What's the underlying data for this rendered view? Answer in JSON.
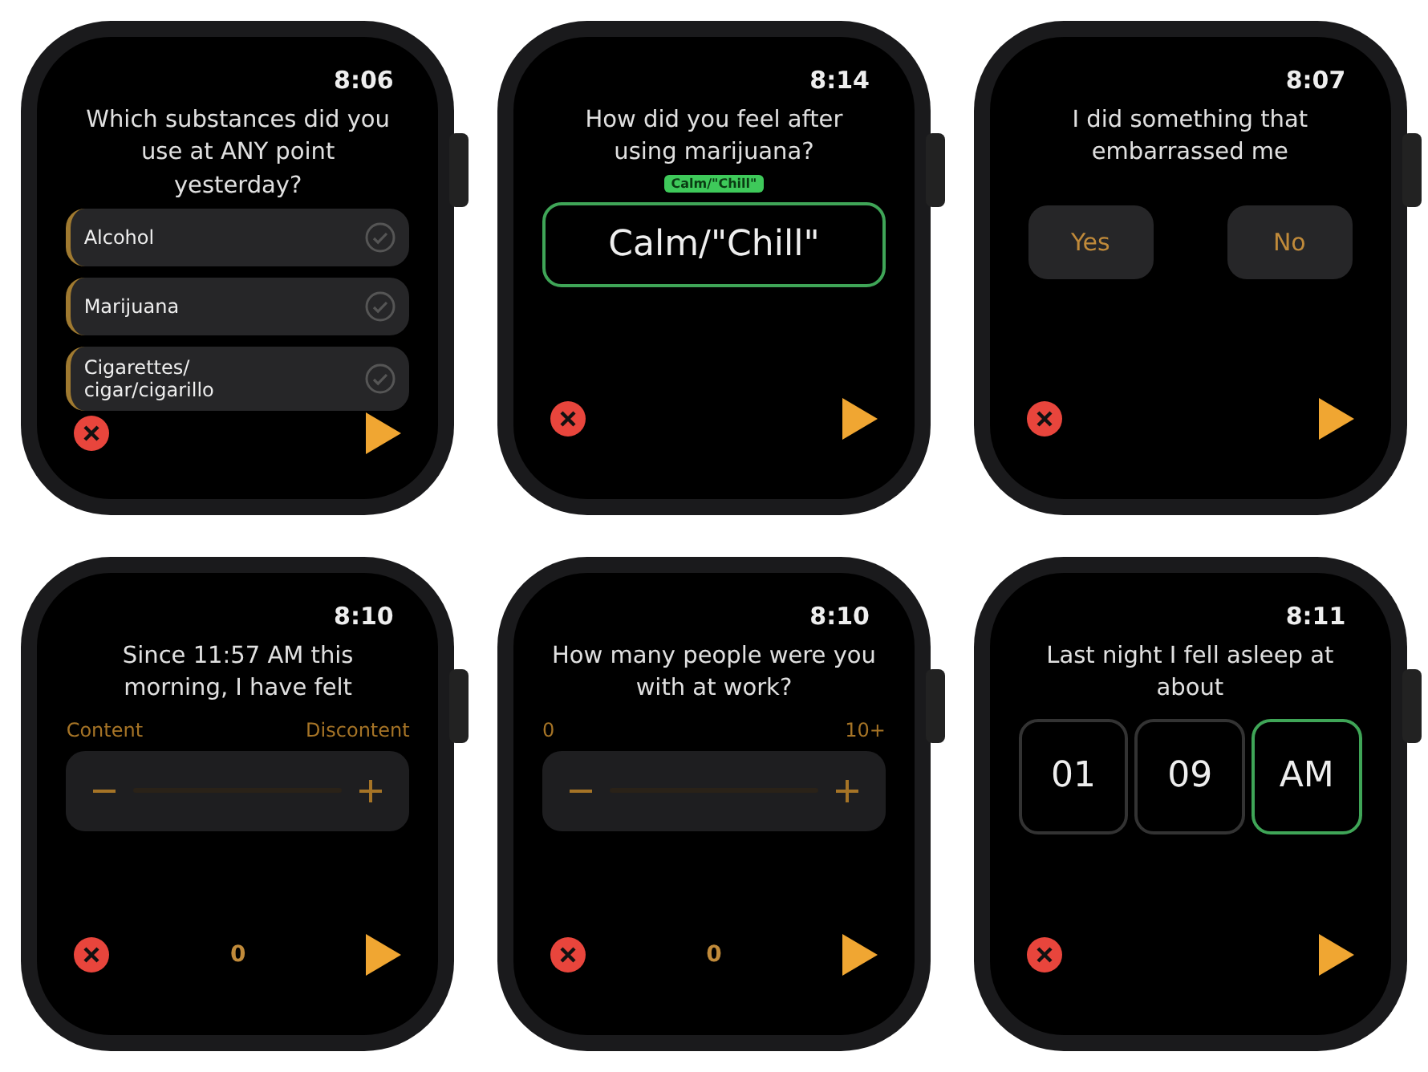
{
  "watches": [
    {
      "kind": "checklist",
      "time": "8:06",
      "question": "Which substances did you use at ANY point yesterday?",
      "options": [
        {
          "label": "Alcohol",
          "checked": false
        },
        {
          "label": "Marijuana",
          "checked": false
        },
        {
          "label": "Cigarettes/ cigar/cigarillo",
          "checked": false
        }
      ]
    },
    {
      "kind": "choice_text",
      "time": "8:14",
      "question": "How did you feel after using marijuana?",
      "tag": "Calm/\"Chill\"",
      "value": "Calm/\"Chill\""
    },
    {
      "kind": "yes_no",
      "time": "8:07",
      "question": "I did something that embarrassed me",
      "buttons": [
        "Yes",
        "No"
      ]
    },
    {
      "kind": "stepper",
      "time": "8:10",
      "question": "Since 11:57 AM this morning, I have felt",
      "min_label": "Content",
      "max_label": "Discontent",
      "value": "0"
    },
    {
      "kind": "stepper",
      "time": "8:10",
      "question": "How many people were you with at work?",
      "min_label": "0",
      "max_label": "10+",
      "value": "0"
    },
    {
      "kind": "time_picker",
      "time": "8:11",
      "question": "Last night I fell asleep at about",
      "fields": [
        {
          "value": "01",
          "selected": false
        },
        {
          "value": "09",
          "selected": false
        },
        {
          "value": "AM",
          "selected": true
        }
      ]
    }
  ]
}
